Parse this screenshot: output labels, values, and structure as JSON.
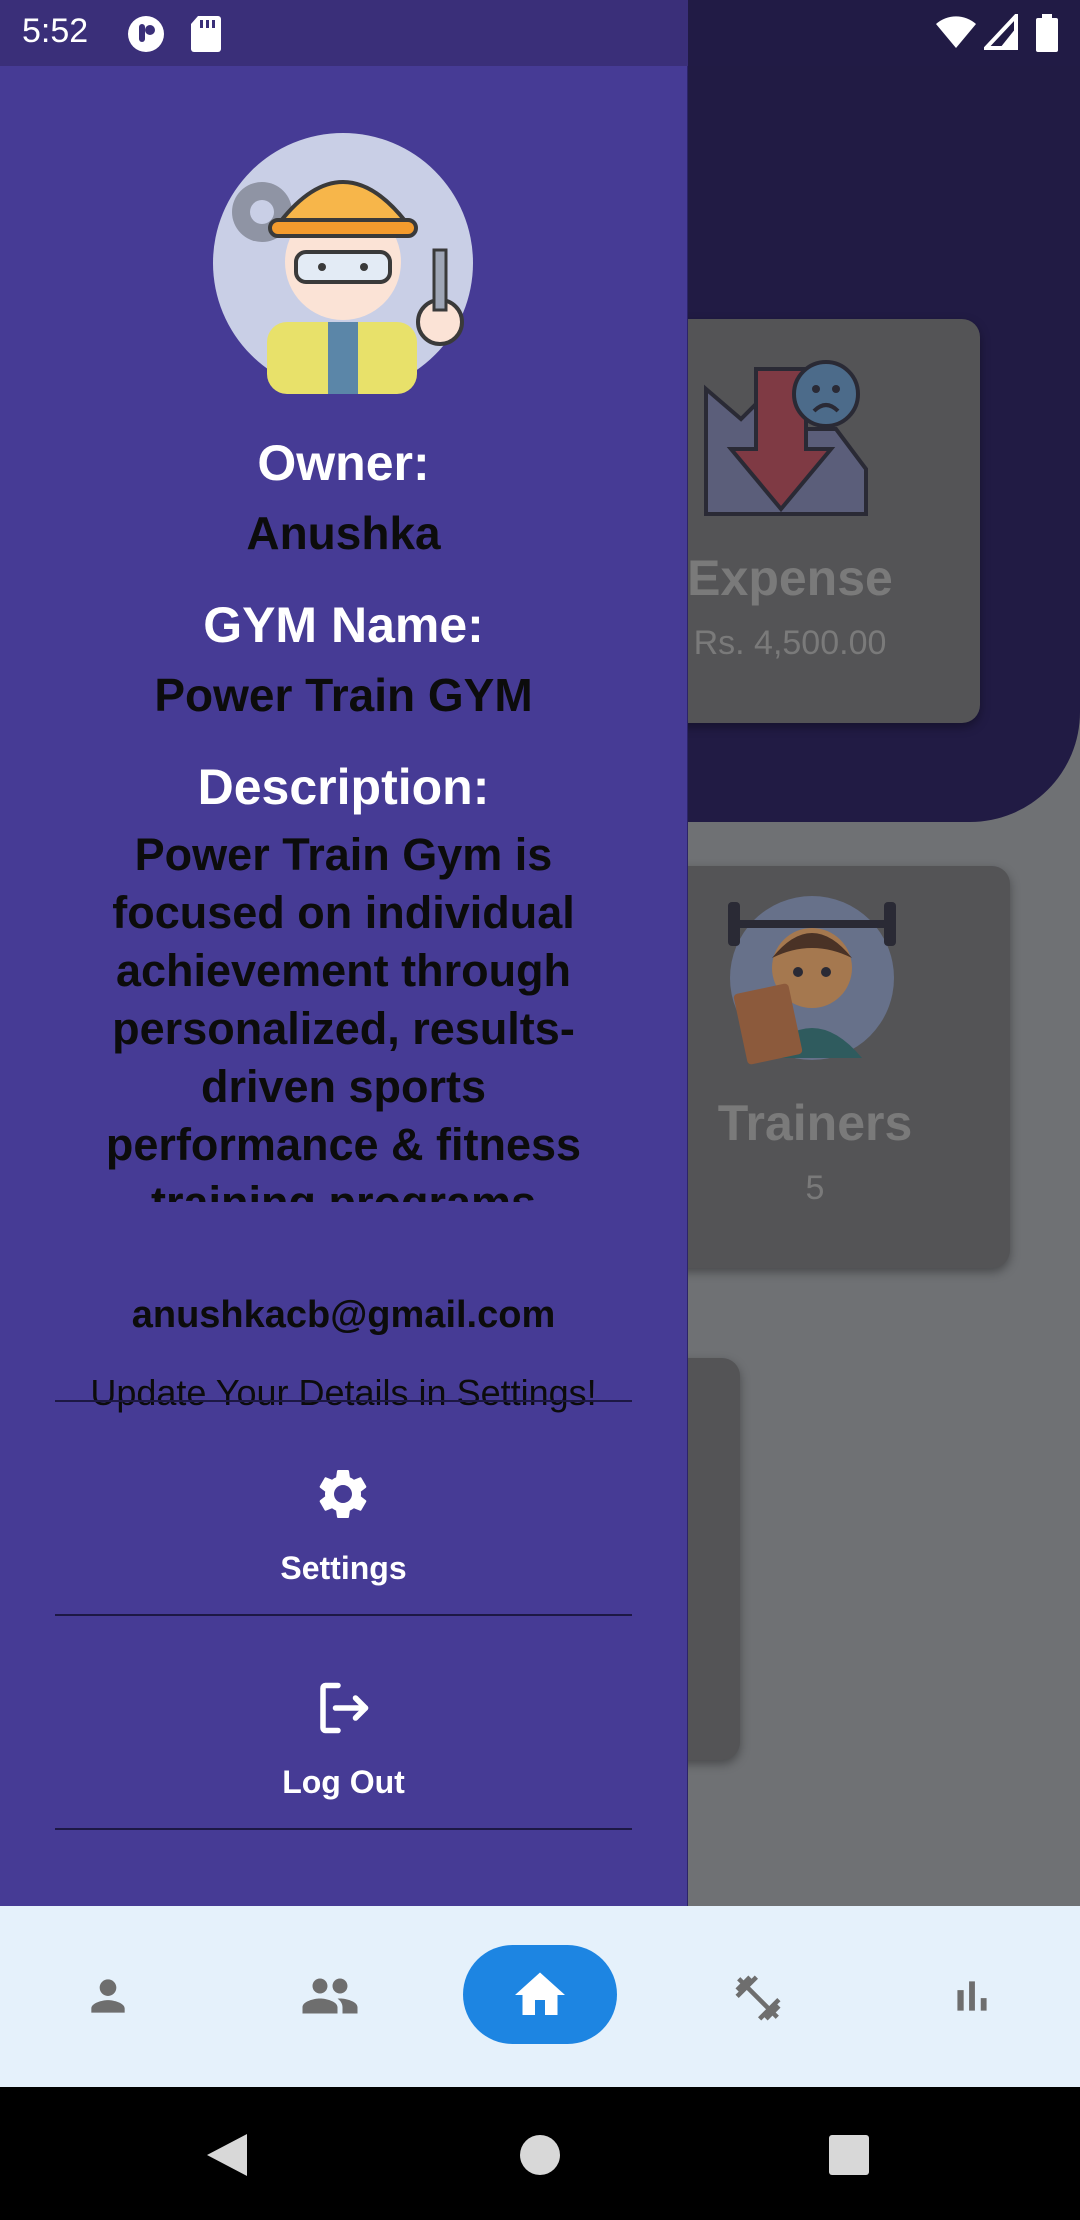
{
  "status_bar": {
    "time": "5:52"
  },
  "dashboard": {
    "cards": [
      {
        "title": "Expense",
        "value": "Rs. 4,500.00"
      },
      {
        "title": "Trainers",
        "value": "5"
      }
    ]
  },
  "drawer": {
    "owner_label": "Owner:",
    "owner_name": "Anushka",
    "gym_label": "GYM Name:",
    "gym_name": "Power Train GYM",
    "description_label": "Description:",
    "description": "Power Train Gym is focused on individual achievement through personalized, results-driven sports performance & fitness training programs",
    "email": "anushkacb@gmail.com",
    "update_hint": "Update Your Details in Settings!",
    "menu": [
      {
        "label": "Settings",
        "icon": "gear-icon"
      },
      {
        "label": "Log Out",
        "icon": "logout-icon"
      }
    ]
  },
  "bottom_nav": {
    "items": [
      "person-icon",
      "group-icon",
      "home-icon",
      "dumbbell-icon",
      "bar-chart-icon"
    ],
    "active": "home-icon"
  },
  "colors": {
    "drawer_bg": "#463b95",
    "header_bg": "#211b44",
    "accent": "#1d85e2",
    "bottom_nav_bg": "#e5f1fb"
  }
}
